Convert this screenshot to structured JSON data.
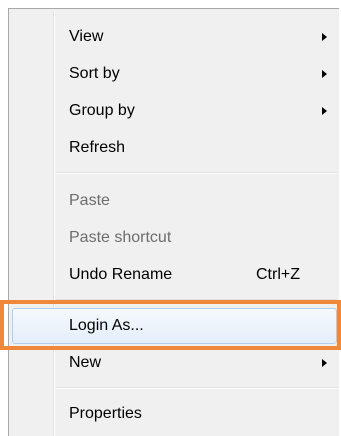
{
  "menu": {
    "items": [
      {
        "label": "View",
        "submenu": true,
        "disabled": false
      },
      {
        "label": "Sort by",
        "submenu": true,
        "disabled": false
      },
      {
        "label": "Group by",
        "submenu": true,
        "disabled": false
      },
      {
        "label": "Refresh",
        "submenu": false,
        "disabled": false
      },
      {
        "label": "Paste",
        "submenu": false,
        "disabled": true
      },
      {
        "label": "Paste shortcut",
        "submenu": false,
        "disabled": true
      },
      {
        "label": "Undo Rename",
        "shortcut": "Ctrl+Z",
        "submenu": false,
        "disabled": false
      },
      {
        "label": "Login As...",
        "submenu": false,
        "disabled": false,
        "highlighted": true
      },
      {
        "label": "New",
        "submenu": true,
        "disabled": false
      },
      {
        "label": "Properties",
        "submenu": false,
        "disabled": false
      }
    ]
  },
  "highlight_color": "#f0883a"
}
